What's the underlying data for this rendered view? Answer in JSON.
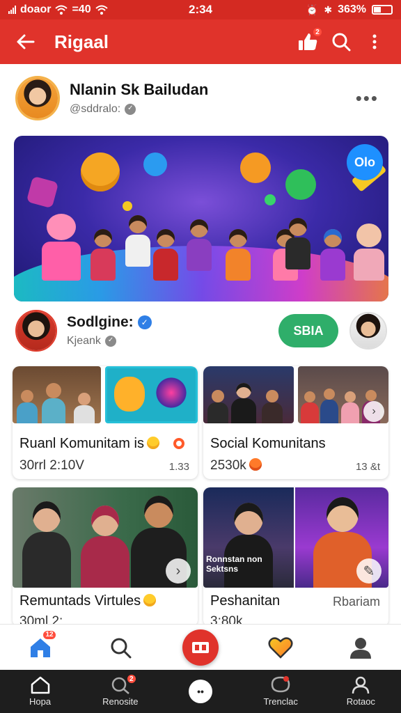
{
  "status_bar": {
    "left_text": "doaor",
    "signal_text": "=40",
    "time": "2:34",
    "battery": "363%"
  },
  "app_bar": {
    "title": "Rigaal",
    "notification_badge": "2"
  },
  "profile": {
    "name": "Nlanin Sk Bailudan",
    "handle": "@sddralo:"
  },
  "hero": {
    "chip_text": "Olo"
  },
  "creator": {
    "name": "Sodlgine:",
    "handle": "Kjeank",
    "follow_label": "SBIA"
  },
  "cards": [
    {
      "title": "Ruanl Komunitam is",
      "stat": "30rrl 2:10V",
      "right": "1.33"
    },
    {
      "title": "Social Komunitans",
      "stat": "2530k",
      "right": "13 &t"
    },
    {
      "title": "Remuntads Virtules",
      "stat": "30ml 2:",
      "right": ""
    },
    {
      "title": "Peshanitan",
      "stat": "3:80k",
      "right": "Rbariam",
      "overlay_line1": "Ronnstan non",
      "overlay_line2": "Sektsns"
    }
  ],
  "tab_bar": {
    "home_badge": "12"
  },
  "nav_bar": [
    {
      "label": "Hopa"
    },
    {
      "label": "Renosite",
      "badge": "2"
    },
    {
      "label": "",
      "dot": "••"
    },
    {
      "label": "Trenclac"
    },
    {
      "label": "Rotaoc"
    }
  ],
  "colors": {
    "brand_red": "#e0332b",
    "status_red": "#d42a22",
    "follow_green": "#2fae6a",
    "verified_blue": "#2f7fe6"
  },
  "icons": [
    "back-arrow-icon",
    "thumbs-up-icon",
    "search-icon",
    "more-vert-icon",
    "home-icon",
    "heart-icon",
    "profile-icon",
    "create-icon"
  ]
}
